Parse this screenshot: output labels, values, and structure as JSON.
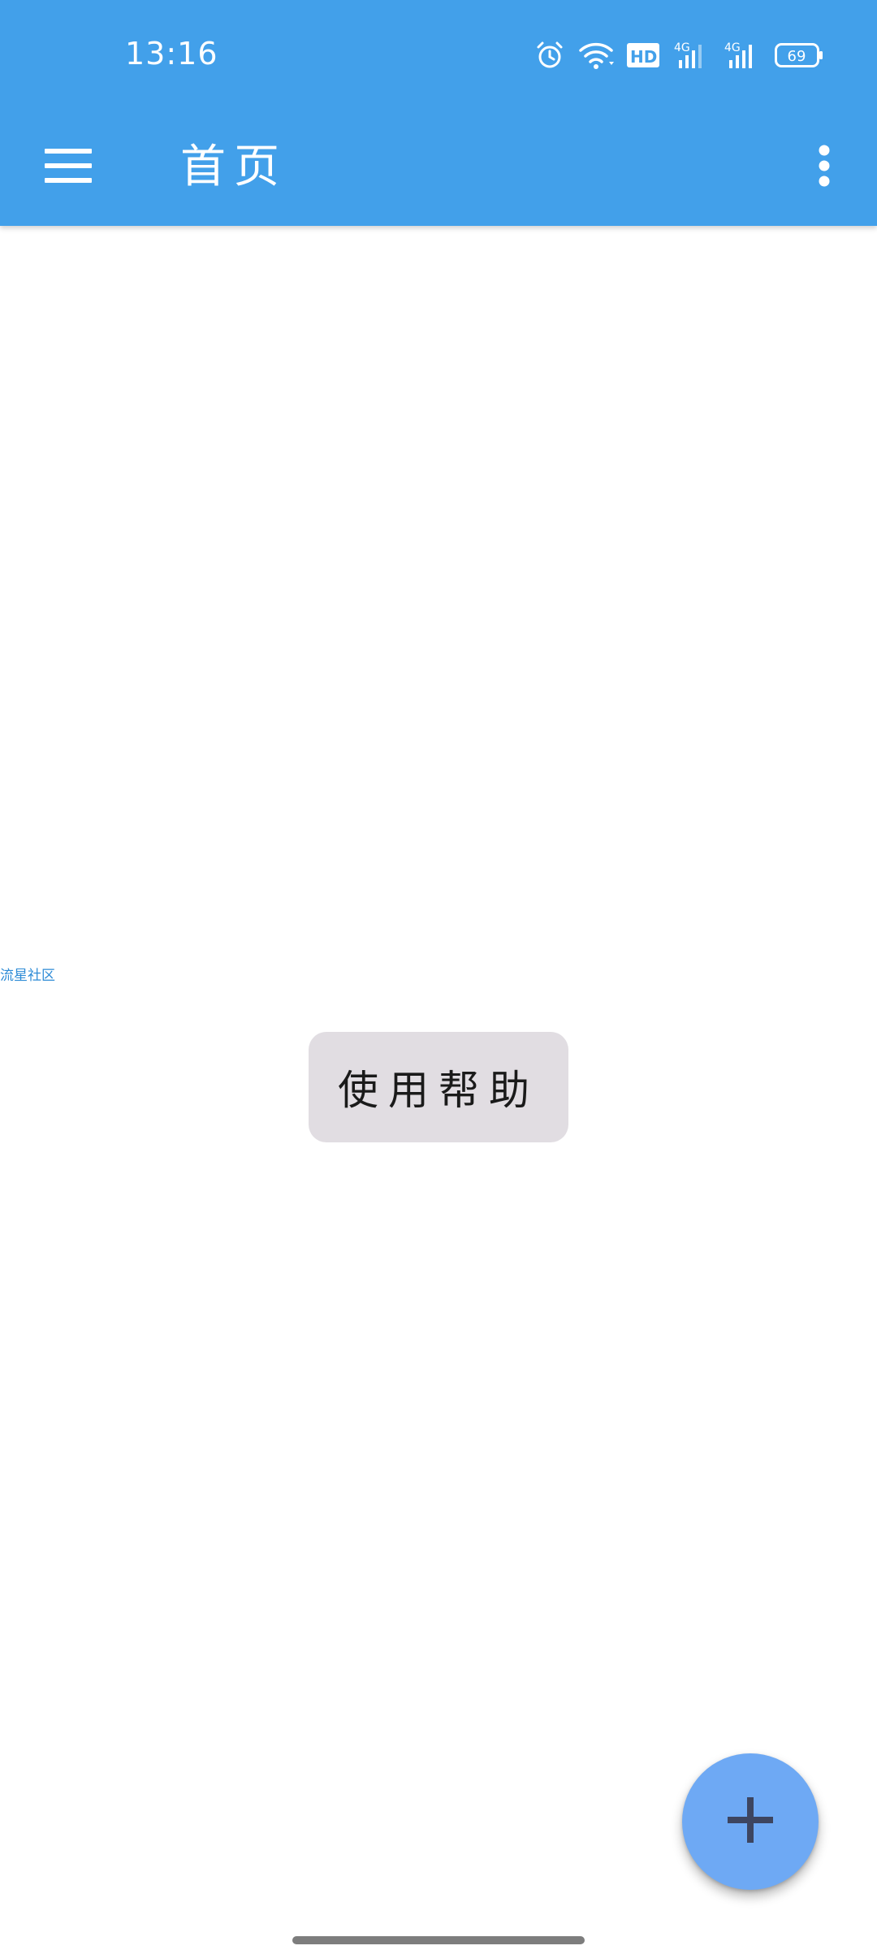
{
  "status_bar": {
    "time": "13:16",
    "icons": [
      "alarm-icon",
      "wifi-icon",
      "hd-voice-icon",
      "signal-4g-1-icon",
      "signal-4g-2-icon",
      "battery-icon"
    ],
    "hd_label": "HD",
    "network_1": "4G",
    "network_2": "4G",
    "battery_level": "69"
  },
  "app_bar": {
    "title": "首页",
    "menu_icon": "hamburger-menu-icon",
    "overflow_icon": "more-vertical-icon"
  },
  "main": {
    "community_link": "流星社区",
    "help_button_label": "使用帮助"
  },
  "fab": {
    "icon": "plus-icon"
  },
  "colors": {
    "primary": "#42a0ea",
    "fab": "#6ea9f4",
    "fab_icon": "#3d4560",
    "help_button_bg": "#e1dde2",
    "link": "#2d8bd6"
  }
}
